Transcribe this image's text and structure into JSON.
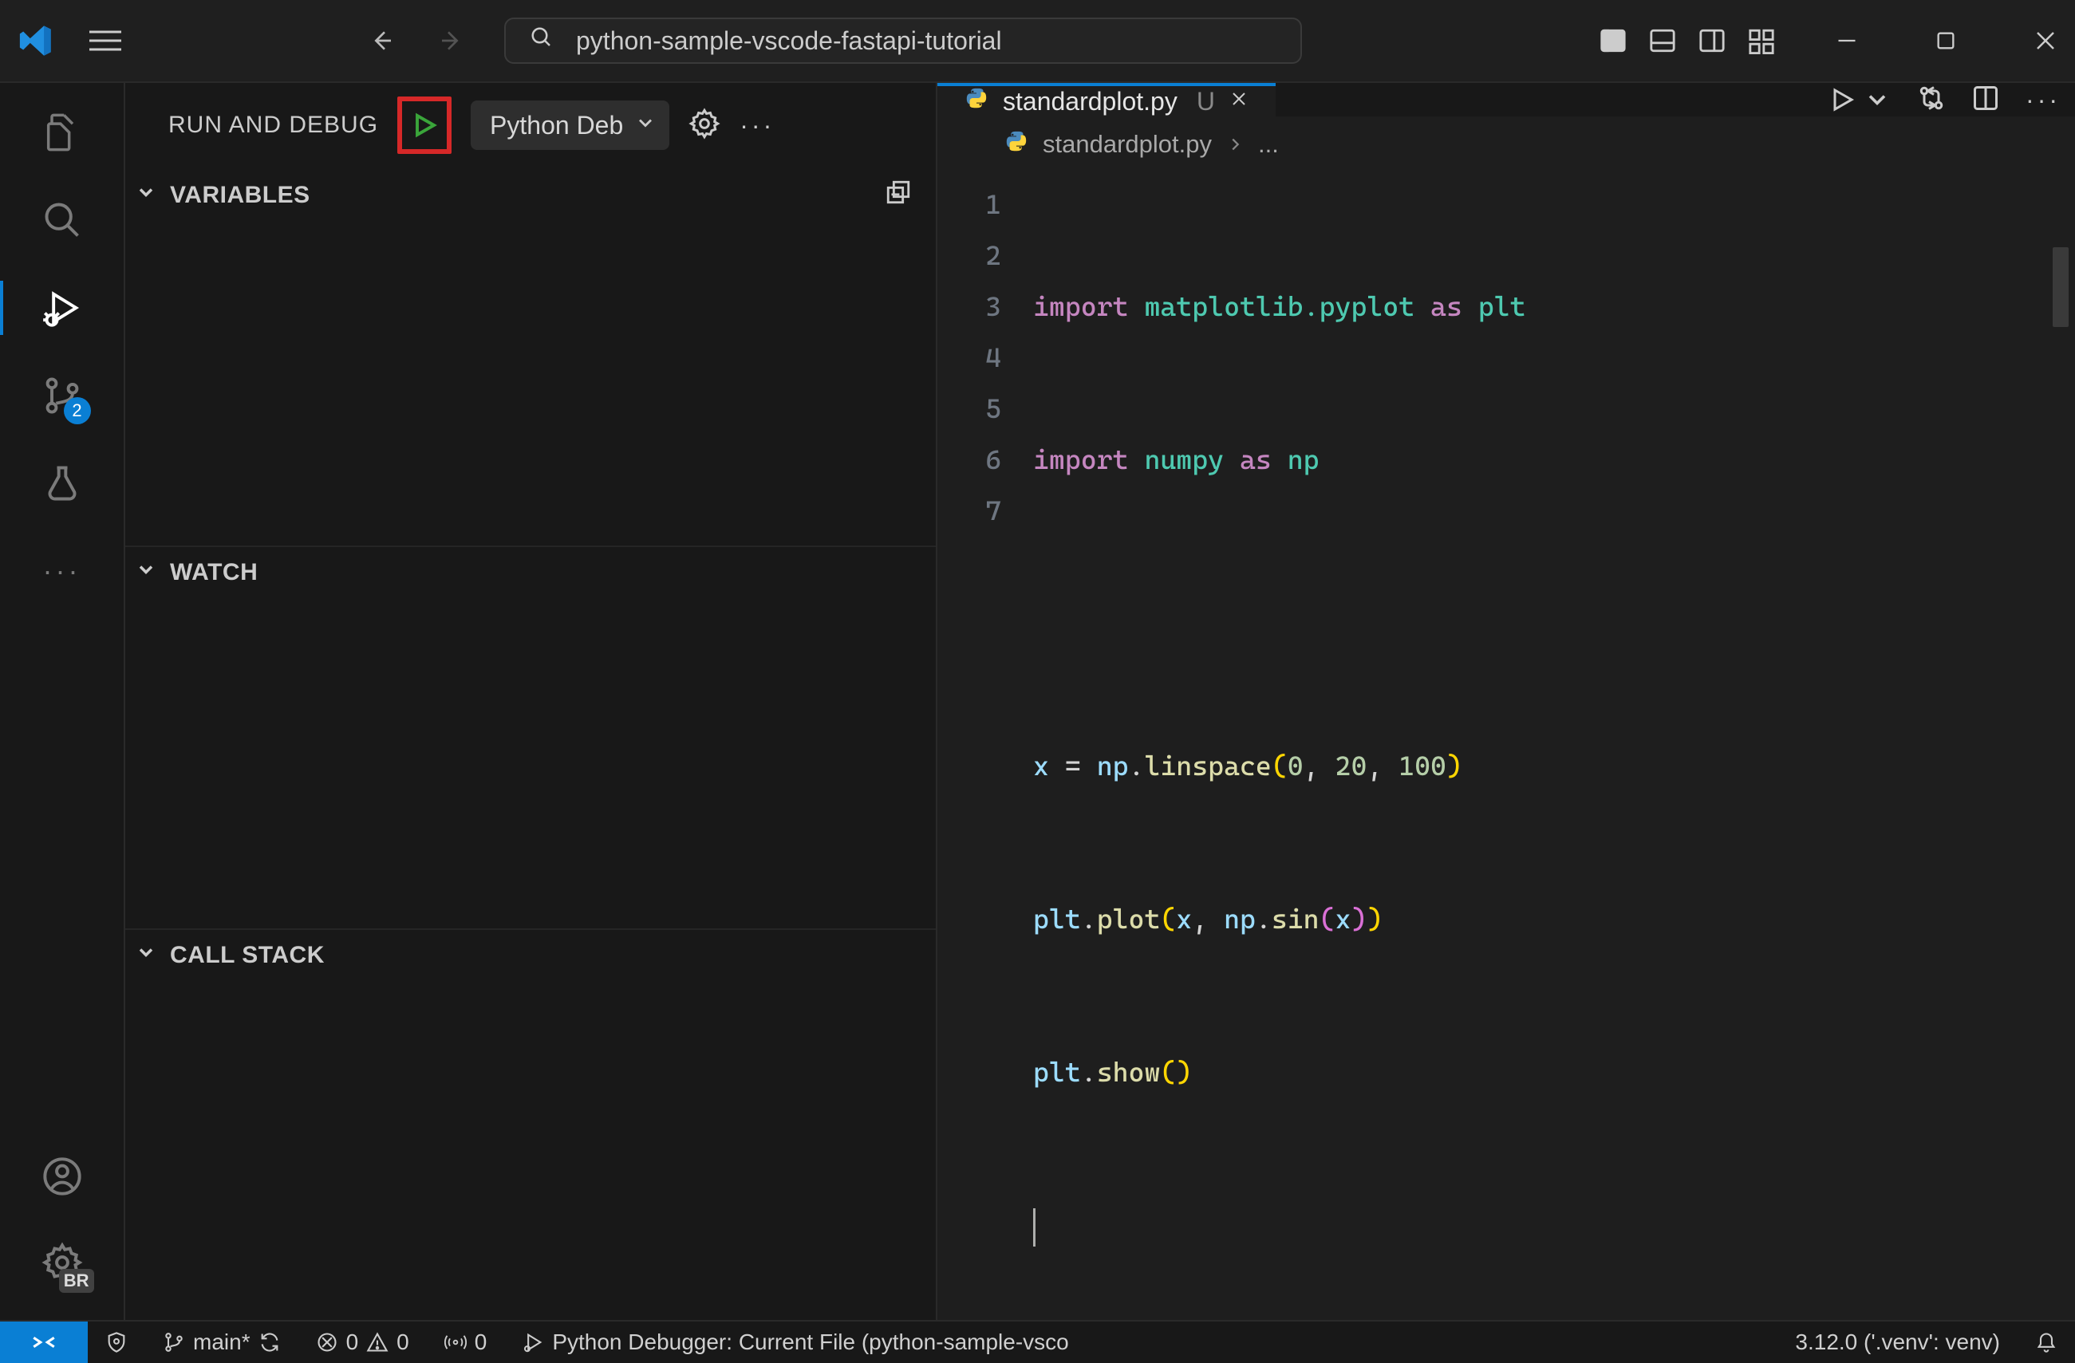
{
  "titlebar": {
    "search_text": "python-sample-vscode-fastapi-tutorial"
  },
  "activity": {
    "badge_source_count": "2",
    "bottom_badge": "BR"
  },
  "sidebar": {
    "title": "RUN AND DEBUG",
    "config_selected": "Python Deb",
    "sections": {
      "variables": "VARIABLES",
      "watch": "WATCH",
      "callstack": "CALL STACK"
    }
  },
  "editor": {
    "tab_file": "standardplot.py",
    "tab_status": "U",
    "breadcrumb_file": "standardplot.py",
    "breadcrumb_tail": "...",
    "line_numbers": [
      "1",
      "2",
      "3",
      "4",
      "5",
      "6",
      "7"
    ],
    "code": {
      "l1": {
        "kw": "import",
        "pkg": "matplotlib.pyplot",
        "as": "as",
        "alias": "plt"
      },
      "l2": {
        "kw": "import",
        "pkg": "numpy",
        "as": "as",
        "alias": "np"
      },
      "l4": {
        "var": "x",
        "eq": "=",
        "obj": "np",
        "dot": ".",
        "fn": "linspace",
        "lp": "(",
        "n0": "0",
        "c1": ",",
        "sp1": " ",
        "n1": "20",
        "c2": ",",
        "sp2": " ",
        "n2": "100",
        "rp": ")"
      },
      "l5": {
        "obj": "plt",
        "dot": ".",
        "fn": "plot",
        "lp": "(",
        "arg0": "x",
        "c": ",",
        "sp": " ",
        "obj2": "np",
        "dot2": ".",
        "fn2": "sin",
        "lp2": "(",
        "arg1": "x",
        "rp2": ")",
        "rp": ")"
      },
      "l6": {
        "obj": "plt",
        "dot": ".",
        "fn": "show",
        "lp": "(",
        "rp": ")"
      }
    }
  },
  "statusbar": {
    "branch": "main*",
    "errors": "0",
    "warnings": "0",
    "ports": "0",
    "debugger": "Python Debugger: Current File (python-sample-vsco",
    "python": "3.12.0 ('.venv': venv)"
  }
}
